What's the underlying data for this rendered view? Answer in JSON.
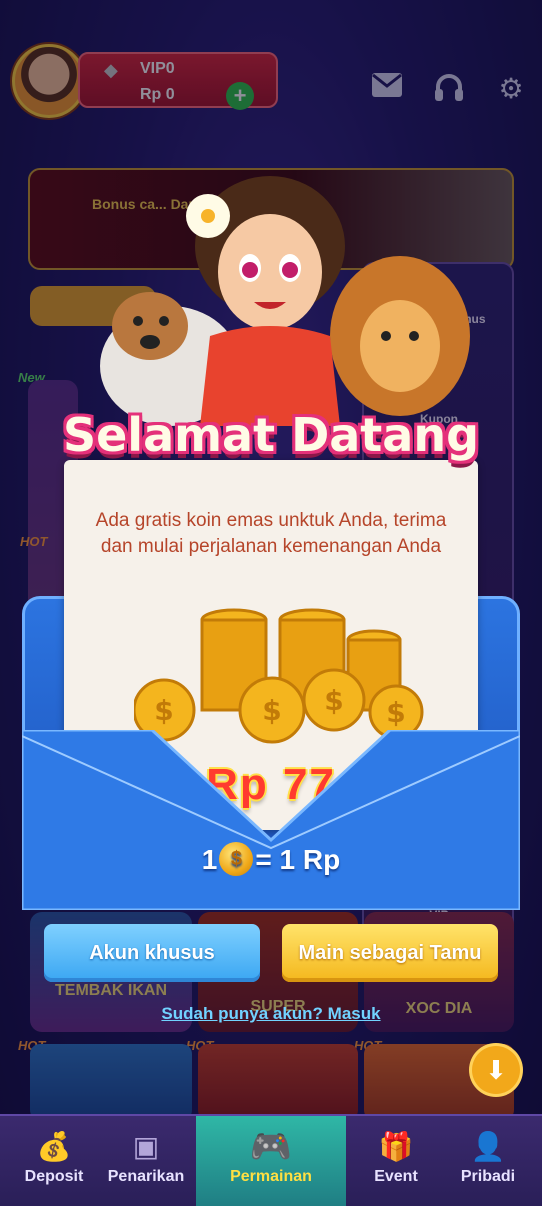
{
  "header": {
    "vip_label": "VIP0",
    "balance": "Rp 0",
    "plus": "+"
  },
  "background": {
    "banner_text": "Bonus ca... Dapatka... dari te...",
    "side_items": [
      "Welcome Bonus",
      "Kupon",
      "VIP"
    ],
    "tiles": [
      "TEMBAK IKAN",
      "SUPER",
      "XOC DIA"
    ],
    "hot": "HOT",
    "new": "New"
  },
  "popup": {
    "title": "Selamat Datang",
    "message": "Ada gratis koin emas unktuk Anda, terima dan mulai perjalanan kemenangan Anda",
    "reward": "Rp  77",
    "rate_left": "1",
    "rate_coin": "$",
    "rate_right": "= 1 Rp",
    "btn_account": "Akun khusus",
    "btn_guest": "Main sebagai Tamu",
    "login_link": "Sudah punya akun? Masuk"
  },
  "nav": {
    "items": [
      {
        "label": "Deposit"
      },
      {
        "label": "Penarikan"
      },
      {
        "label": "Permainan"
      },
      {
        "label": "Event"
      },
      {
        "label": "Pribadi"
      }
    ]
  },
  "colors": {
    "title_outline": "#e4317a",
    "reward": "#ff3b2f",
    "envelope": "#2c74e0",
    "btn_blue": "#3aa6f2",
    "btn_yellow": "#f4b71c",
    "link": "#71d2ff"
  },
  "icons": [
    "vip-diamond-icon",
    "mail-icon",
    "headset-icon",
    "gear-icon",
    "wallet-icon",
    "withdraw-icon",
    "gamepad-icon",
    "gift-icon",
    "profile-icon",
    "arrow-down-icon",
    "coin-icon"
  ]
}
